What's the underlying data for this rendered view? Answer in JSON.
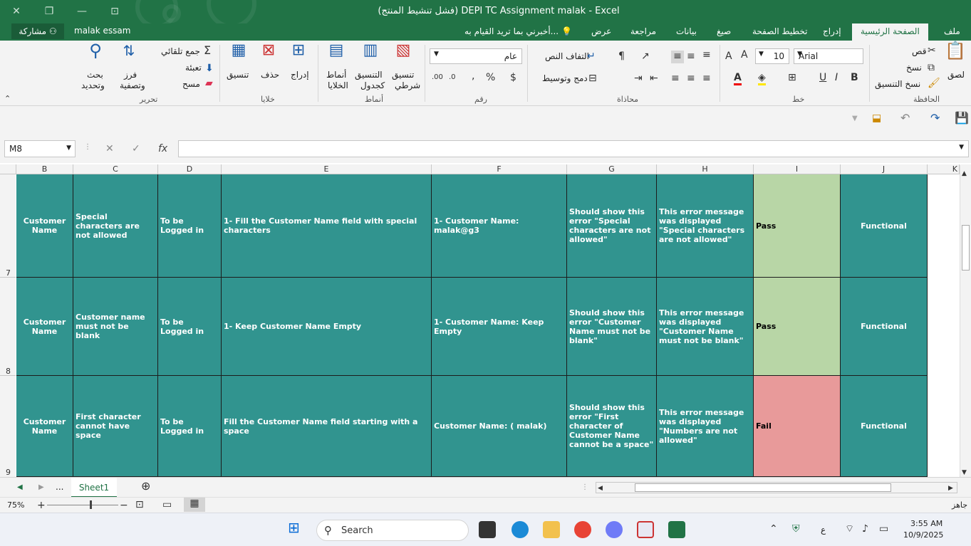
{
  "window": {
    "title": "DEPI TC Assignment malak - Excel",
    "title_suffix": "(فشل تنشيط المنتج)"
  },
  "menubar": {
    "share": "مشاركة",
    "user": "malak essam",
    "tell_me": "أخبرني بما تريد القيام به...",
    "tabs": [
      "ملف",
      "الصفحة الرئيسية",
      "إدراج",
      "تخطيط الصفحة",
      "صيغ",
      "بيانات",
      "مراجعة",
      "عرض"
    ]
  },
  "ribbon": {
    "clipboard": {
      "paste": "لصق",
      "cut": "قص",
      "copy": "نسخ",
      "format_painter": "نسخ التنسيق",
      "label": "الحافظة"
    },
    "font": {
      "name": "Arial",
      "size": "10",
      "label": "خط"
    },
    "alignment": {
      "wrap": "التفاف النص",
      "merge": "دمج وتوسيط",
      "label": "محاذاة"
    },
    "number": {
      "format": "عام",
      "label": "رقم"
    },
    "styles": {
      "conditional": "تنسيق",
      "conditional2": "شرطي",
      "table": "التنسيق",
      "table2": "كجدول",
      "cell_styles": "أنماط",
      "cell_styles2": "الخلايا",
      "label": "أنماط"
    },
    "cells": {
      "insert": "إدراج",
      "delete": "حذف",
      "format": "تنسيق",
      "label": "خلايا"
    },
    "editing": {
      "autosum": "جمع تلقائي",
      "fill": "تعبئة",
      "clear": "مسح",
      "sort": "فرز",
      "sort2": "وتصفية",
      "find": "بحث",
      "find2": "وتحديد",
      "label": "تحرير"
    }
  },
  "formula_bar": {
    "name_box": "M8",
    "fx": "fx",
    "value": ""
  },
  "columns": [
    {
      "label": "B"
    },
    {
      "label": "C"
    },
    {
      "label": "D"
    },
    {
      "label": "E"
    },
    {
      "label": "F"
    },
    {
      "label": "G"
    },
    {
      "label": "H"
    },
    {
      "label": "I"
    },
    {
      "label": "J"
    },
    {
      "label": "K"
    }
  ],
  "rows": [
    {
      "number": "7",
      "cells": [
        "Customer Name",
        " Special characters are not allowed",
        "To be Logged in",
        "1- Fill the Customer Name field with special characters",
        "1- Customer Name: malak@g3",
        "Should show this error \"Special characters are not allowed\"",
        "This error message was displayed \"Special characters are not allowed\"",
        "Pass",
        "Functional"
      ],
      "status": "pass"
    },
    {
      "number": "8",
      "cells": [
        "Customer Name",
        "Customer name must not be blank",
        "To be Logged in",
        "1- Keep Customer Name Empty",
        "1- Customer Name: Keep Empty",
        "Should show this error \"Customer Name must not be blank\"",
        "This error message was displayed \"Customer Name must not be blank\"",
        "Pass",
        "Functional"
      ],
      "status": "pass"
    },
    {
      "number": "9",
      "cells": [
        "Customer Name",
        "First character cannot have space",
        "To be Logged in",
        "Fill the Customer Name field starting with a space",
        " Customer Name: ( malak)",
        "Should show this error \"First character of Customer Name cannot be a space\"",
        "This error message was displayed \"Numbers are not allowed\"",
        "Fail",
        "Functional"
      ],
      "status": "fail"
    }
  ],
  "sheets": {
    "more": "...",
    "active": "Sheet1"
  },
  "status": {
    "zoom": "75%",
    "ready": "جاهز"
  },
  "taskbar": {
    "search": "Search",
    "time": "3:55 AM",
    "date": "10/9/2025",
    "lang": "ع"
  },
  "colors": {
    "excel_green": "#217346",
    "teal": "#31948f",
    "pass": "#b8d6a6",
    "fail": "#e89a9a"
  }
}
